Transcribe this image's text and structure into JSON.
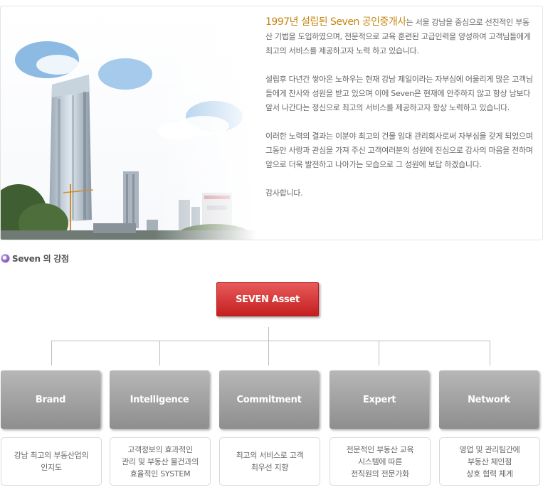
{
  "intro": {
    "lead": "1997년 설립된 Seven 공인중개사",
    "p1_rest": "는 서울 강남을 중심으로 선진적인 부동산 기법을 도입하였으며, 전문적으로 교육 훈련된 고급인력을 양성하여 고객님들에게 최고의 서비스를 제공하고자 노력 하고 있습니다.",
    "p2": "설립후 다년간 쌓아온 노하우는 현재 강남 제일이라는 자부심에 어울리게 많은 고객님들에게 찬사와 성원을 받고 있으며 이에 Seven은 현재에 안주하지 않고 항상 남보다 앞서 나간다는 정신으로 최고의 서비스를 제공하고자 항상 노력하고 있습니다.",
    "p3": "이러한 노력의 결과는 이분야 최고의 건물 임대 관리회사로써 자부심을 갖게 되었으며 그동안 사랑과 관심을 가져 주신 고객여러분의 성원에 진심으로 감사의 마음을 전하며 앞으로 더욱 발전하고 나아가는 모습으로 그 성원에 보답 하겠습니다.",
    "p4": "감사합니다."
  },
  "section": {
    "title": "Seven 의 강점"
  },
  "chart": {
    "root": "SEVEN Asset",
    "items": [
      {
        "label": "Brand",
        "desc": [
          "강남 최고의 부동산업의",
          "인지도"
        ]
      },
      {
        "label": "Intelligence",
        "desc": [
          "고객정보의 효과적인",
          "관리 및 부동산 물건과의",
          "효율적인 SYSTEM"
        ]
      },
      {
        "label": "Commitment",
        "desc": [
          "최고의 서비스로 고객",
          "최우선 지향"
        ]
      },
      {
        "label": "Expert",
        "desc": [
          "전문적인 부동산 교육",
          "시스템에 따른",
          "전직원의 전문가화"
        ]
      },
      {
        "label": "Network",
        "desc": [
          "영업 및 관리팀간에",
          "부동산 체인점",
          "상호 협력 체계"
        ]
      }
    ]
  },
  "colors": {
    "lead": "#c5860f",
    "root_box": "#d33333",
    "category_box": "#a3a3a3"
  },
  "icons": {
    "section_bullet": "purple-circle-bullet-icon"
  }
}
